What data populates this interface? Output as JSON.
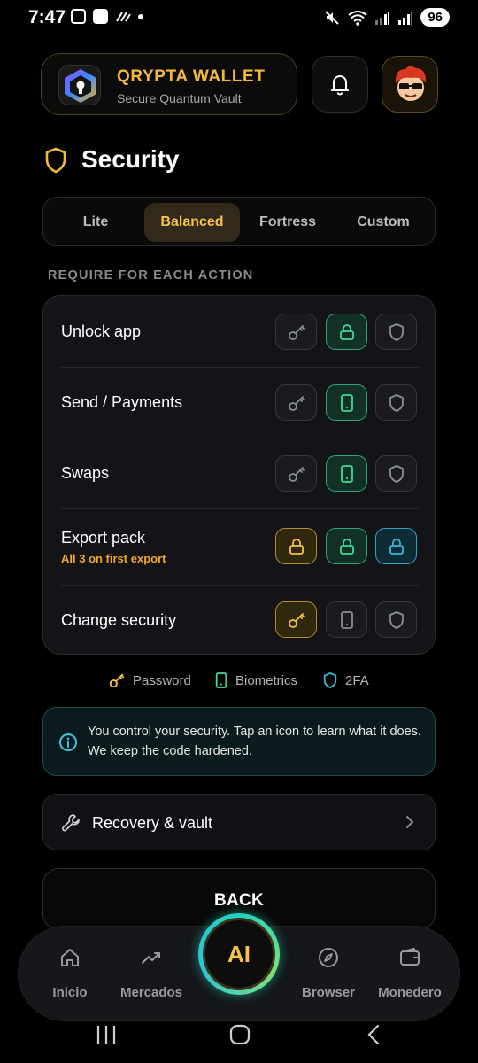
{
  "status_bar": {
    "time": "7:47",
    "battery": "96"
  },
  "header": {
    "app_name": "QRYPTA WALLET",
    "app_subtitle": "Secure Quantum Vault",
    "accent_color": "#f5b93e"
  },
  "page": {
    "title": "Security"
  },
  "preset_tabs": [
    {
      "label": "Lite",
      "active": false
    },
    {
      "label": "Balanced",
      "active": true
    },
    {
      "label": "Fortress",
      "active": false
    },
    {
      "label": "Custom",
      "active": false
    }
  ],
  "section_label": "REQUIRE FOR EACH ACTION",
  "actions": [
    {
      "label": "Unlock app",
      "sub": "",
      "methods": [
        {
          "icon": "key-icon",
          "state": "off"
        },
        {
          "icon": "lock-icon",
          "state": "on-green"
        },
        {
          "icon": "shield-icon",
          "state": "off"
        }
      ]
    },
    {
      "label": "Send / Payments",
      "sub": "",
      "methods": [
        {
          "icon": "key-icon",
          "state": "off"
        },
        {
          "icon": "phone-icon",
          "state": "on-green"
        },
        {
          "icon": "shield-icon",
          "state": "off"
        }
      ]
    },
    {
      "label": "Swaps",
      "sub": "",
      "methods": [
        {
          "icon": "key-icon",
          "state": "off"
        },
        {
          "icon": "phone-icon",
          "state": "on-green"
        },
        {
          "icon": "shield-icon",
          "state": "off"
        }
      ]
    },
    {
      "label": "Export pack",
      "sub": "All 3 on first export",
      "methods": [
        {
          "icon": "lock-icon",
          "state": "on-yellow"
        },
        {
          "icon": "lock-icon",
          "state": "on-green"
        },
        {
          "icon": "lock-icon",
          "state": "on-cyan"
        }
      ]
    },
    {
      "label": "Change security",
      "sub": "",
      "methods": [
        {
          "icon": "key-icon",
          "state": "on-yellow"
        },
        {
          "icon": "phone-icon",
          "state": "off"
        },
        {
          "icon": "shield-icon",
          "state": "off"
        }
      ]
    }
  ],
  "legend": [
    {
      "icon": "key-icon",
      "label": "Password",
      "color": "#f5c24a"
    },
    {
      "icon": "phone-icon",
      "label": "Biometrics",
      "color": "#3ddc97"
    },
    {
      "icon": "shield-icon",
      "label": "2FA",
      "color": "#3bb8d8"
    }
  ],
  "info": {
    "text": "You control your security. Tap an icon to learn what it does. We keep the code hardened."
  },
  "recovery": {
    "label": "Recovery & vault"
  },
  "back_button": {
    "label": "BACK"
  },
  "bottom_nav": {
    "items": [
      {
        "label": "Inicio",
        "icon": "home-icon"
      },
      {
        "label": "Mercados",
        "icon": "trend-icon"
      },
      {
        "label": "Browser",
        "icon": "compass-icon"
      },
      {
        "label": "Monedero",
        "icon": "wallet-icon"
      }
    ],
    "ai_label": "AI"
  }
}
